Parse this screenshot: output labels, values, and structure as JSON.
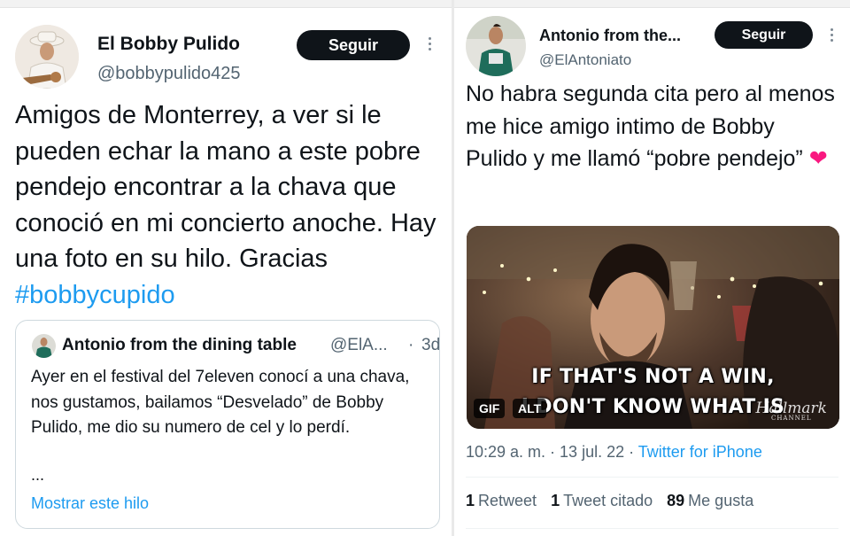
{
  "left_tweet": {
    "author": {
      "name": "El Bobby Pulido",
      "handle": "@bobbypulido425"
    },
    "follow_label": "Seguir",
    "text": "Amigos de Monterrey, a ver si le pueden echar la mano a este pobre pendejo encontrar a la chava que conoció en mi concierto anoche. Hay una foto en su hilo. Gracias ",
    "hashtag": "#bobbycupido",
    "quote": {
      "name": "Antonio from the dining table",
      "handle": "@ElA...",
      "separator": "·",
      "time": "3d",
      "text": "Ayer en el festival del 7eleven conocí a una chava, nos gustamos, bailamos “Desvelado” de Bobby Pulido, me dio su numero de cel y lo perdí.",
      "ellipsis": "...",
      "show_thread": "Mostrar este hilo"
    }
  },
  "right_tweet": {
    "author": {
      "name": "Antonio from the...",
      "handle": "@ElAntoniato"
    },
    "follow_label": "Seguir",
    "text": "No habra segunda cita pero al menos me hice amigo intimo de Bobby Pulido y me llamó “pobre pendejo” ",
    "emoji": "❤",
    "media": {
      "caption_line1": "IF THAT'S NOT A WIN,",
      "caption_line2": "I DON'T KNOW WHAT IS",
      "gif_badge": "GIF",
      "alt_badge": "ALT",
      "watermark": "Hallmark",
      "watermark_sub": "CHANNEL"
    },
    "timestamp": "10:29 a. m. · 13 jul. 22 · ",
    "source": "Twitter for iPhone",
    "stats": {
      "retweets_count": "1",
      "retweets_label": "Retweet",
      "quotes_count": "1",
      "quotes_label": "Tweet citado",
      "likes_count": "89",
      "likes_label": "Me gusta"
    }
  },
  "colors": {
    "link": "#1d9bf0",
    "text": "#0f1419",
    "muted": "#536471",
    "button": "#0f1419",
    "heart": "#f91880"
  }
}
